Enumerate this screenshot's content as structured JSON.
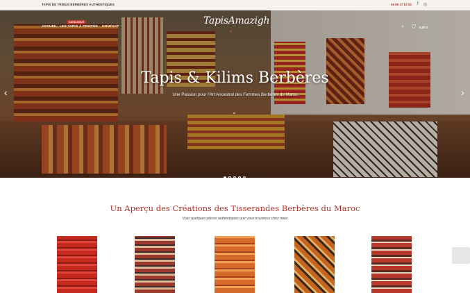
{
  "topbar": {
    "tagline": "TAPIS DE TRIBUS BERBÈRES AUTHENTIQUES",
    "phone": "06 85 37 62 62",
    "social_icons": [
      "facebook-icon",
      "instagram-icon"
    ]
  },
  "nav": {
    "items": [
      "ACCUEIL",
      "LES TAPIS",
      "À PROPOS",
      "CONTACT"
    ],
    "badge": "CATALOGUE"
  },
  "logo": {
    "text": "TapisAmazigh"
  },
  "cart": {
    "amount": "0,00 €"
  },
  "hero": {
    "title": "Tapis & Kilims Berbères",
    "subtitle": "Une Passion pour l'Art Ancestral des Femmes Berbères du Maroc",
    "slides_count": 5,
    "active_slide": 1
  },
  "section": {
    "title": "Un Aperçu des Créations des Tisserandes Berbères du Maroc",
    "subtitle": "Voici quelques pièces authentiques que vous trouverez chez nous"
  },
  "products": [
    {
      "name": "red-rug-1",
      "colors": [
        "#c62a1f",
        "#e0443a"
      ]
    },
    {
      "name": "kilim-stripes",
      "colors": [
        "#9b3a2c",
        "#d9b89a"
      ]
    },
    {
      "name": "orange-rug",
      "colors": [
        "#d66a2a",
        "#f0a050"
      ]
    },
    {
      "name": "diamond-kilim",
      "colors": [
        "#c4641e",
        "#3a2a1e"
      ]
    },
    {
      "name": "red-kilim-2",
      "colors": [
        "#b8382c",
        "#e8d8c0"
      ]
    }
  ],
  "colors": {
    "accent": "#b0332a",
    "topbar": "#f6f3ef"
  }
}
